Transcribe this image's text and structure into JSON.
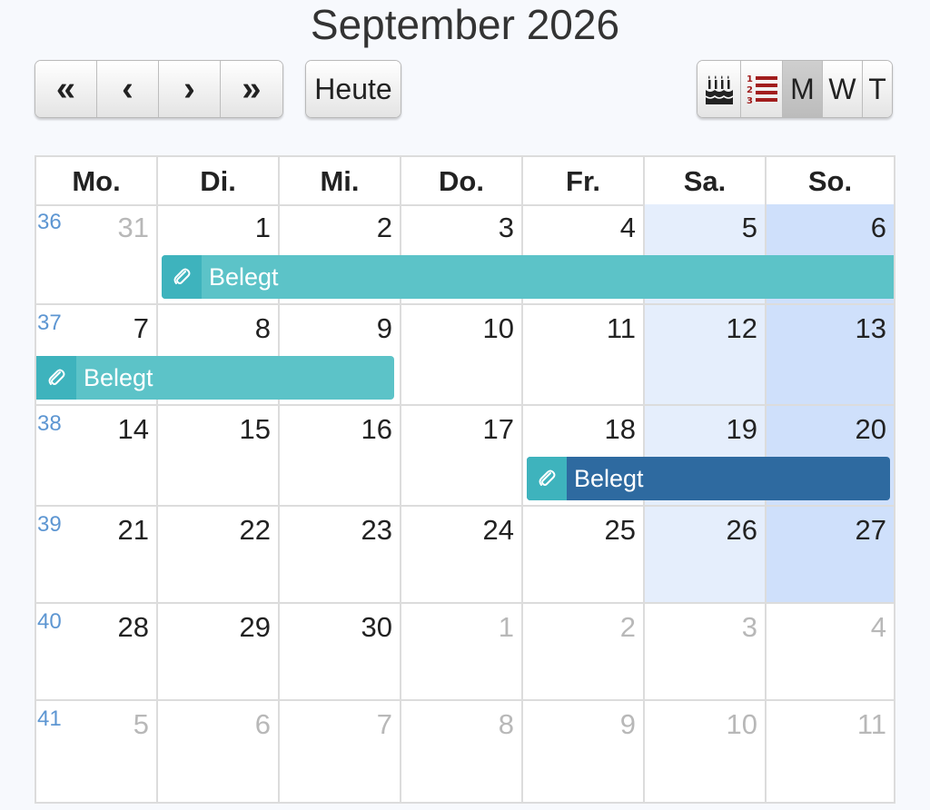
{
  "title": "September 2026",
  "toolbar": {
    "prev_year": "«",
    "prev": "‹",
    "next": "›",
    "next_year": "»",
    "today": "Heute",
    "view_birthdays_icon": "birthday-cake-icon",
    "view_list_icon": "numbered-list-icon",
    "view_month": "M",
    "view_week": "W",
    "view_day": "T"
  },
  "weekdays": [
    "Mo.",
    "Di.",
    "Mi.",
    "Do.",
    "Fr.",
    "Sa.",
    "So."
  ],
  "weeks": [
    {
      "week": "36",
      "days": [
        "31",
        "1",
        "2",
        "3",
        "4",
        "5",
        "6"
      ]
    },
    {
      "week": "37",
      "days": [
        "7",
        "8",
        "9",
        "10",
        "11",
        "12",
        "13"
      ]
    },
    {
      "week": "38",
      "days": [
        "14",
        "15",
        "16",
        "17",
        "18",
        "19",
        "20"
      ]
    },
    {
      "week": "39",
      "days": [
        "21",
        "22",
        "23",
        "24",
        "25",
        "26",
        "27"
      ]
    },
    {
      "week": "40",
      "days": [
        "28",
        "29",
        "30",
        "1",
        "2",
        "3",
        "4"
      ]
    },
    {
      "week": "41",
      "days": [
        "5",
        "6",
        "7",
        "8",
        "9",
        "10",
        "11"
      ]
    }
  ],
  "events": [
    {
      "label": "Belegt",
      "icon": "paperclip-icon",
      "color": "#5cc3c8"
    },
    {
      "label": "Belegt",
      "icon": "paperclip-icon",
      "color": "#5cc3c8"
    },
    {
      "label": "Belegt",
      "icon": "paperclip-icon",
      "color": "#2e6aa0"
    }
  ],
  "colors": {
    "saturday_bg": "#e5eefc",
    "sunday_bg": "#cfe0fb",
    "week_number": "#5d96d2",
    "muted_day": "#b8b8b8"
  }
}
